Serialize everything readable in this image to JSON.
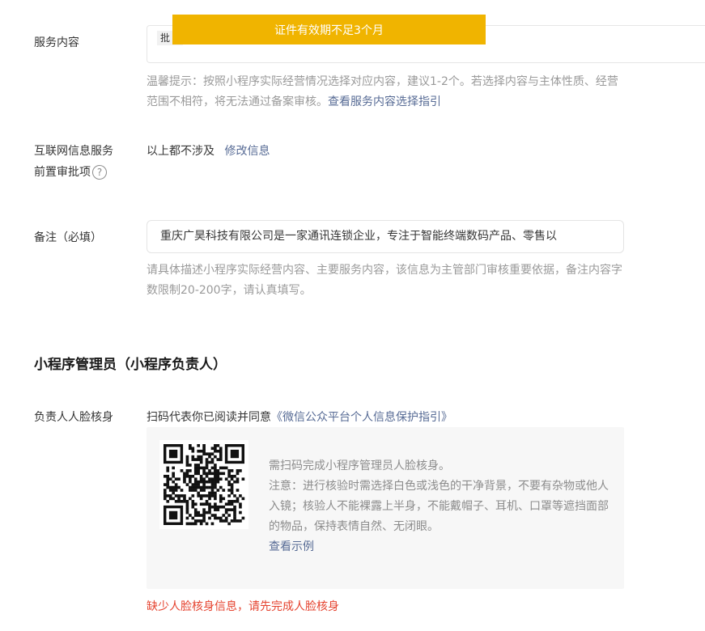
{
  "toast": {
    "text": "证件有效期不足3个月"
  },
  "service": {
    "label": "服务内容",
    "tag": "批",
    "hint_text": "温馨提示：按照小程序实际经营情况选择对应内容，建议1-2个。若选择内容与主体性质、经营范围不相符，将无法通过备案审核。",
    "hint_link": "查看服务内容选择指引"
  },
  "internet": {
    "label_line1": "互联网信息服务",
    "label_line2": "前置审批项",
    "help_icon": "?",
    "value": "以上都不涉及",
    "link": "修改信息"
  },
  "remark": {
    "label": "备注（必填）",
    "value": "重庆广昊科技有限公司是一家通讯连锁企业，专注于智能终端数码产品、零售以",
    "hint": "请具体描述小程序实际经营内容、主要服务内容，该信息为主管部门审核重要依据，备注内容字数限制20-200字，请认真填写。"
  },
  "admin_section": {
    "title": "小程序管理员（小程序负责人）"
  },
  "face": {
    "label": "负责人人脸核身",
    "agree_prefix": "扫码代表你已阅读并同意",
    "agree_link": "《微信公众平台个人信息保护指引》",
    "qr_line1": "需扫码完成小程序管理员人脸核身。",
    "qr_note": "注意：进行核验时需选择白色或浅色的干净背景，不要有杂物或他人入镜；核验人不能裸露上半身，不能戴帽子、耳机、口罩等遮挡面部的物品，保持表情自然、无闭眼。",
    "example_link": "查看示例",
    "error": "缺少人脸核身信息，请先完成人脸核身"
  },
  "colors": {
    "link": "#576b95",
    "error": "#e5432f",
    "toast": "#f0b400"
  },
  "icons": {
    "qr_code": "qr-code-icon",
    "help": "question-circle-icon"
  }
}
